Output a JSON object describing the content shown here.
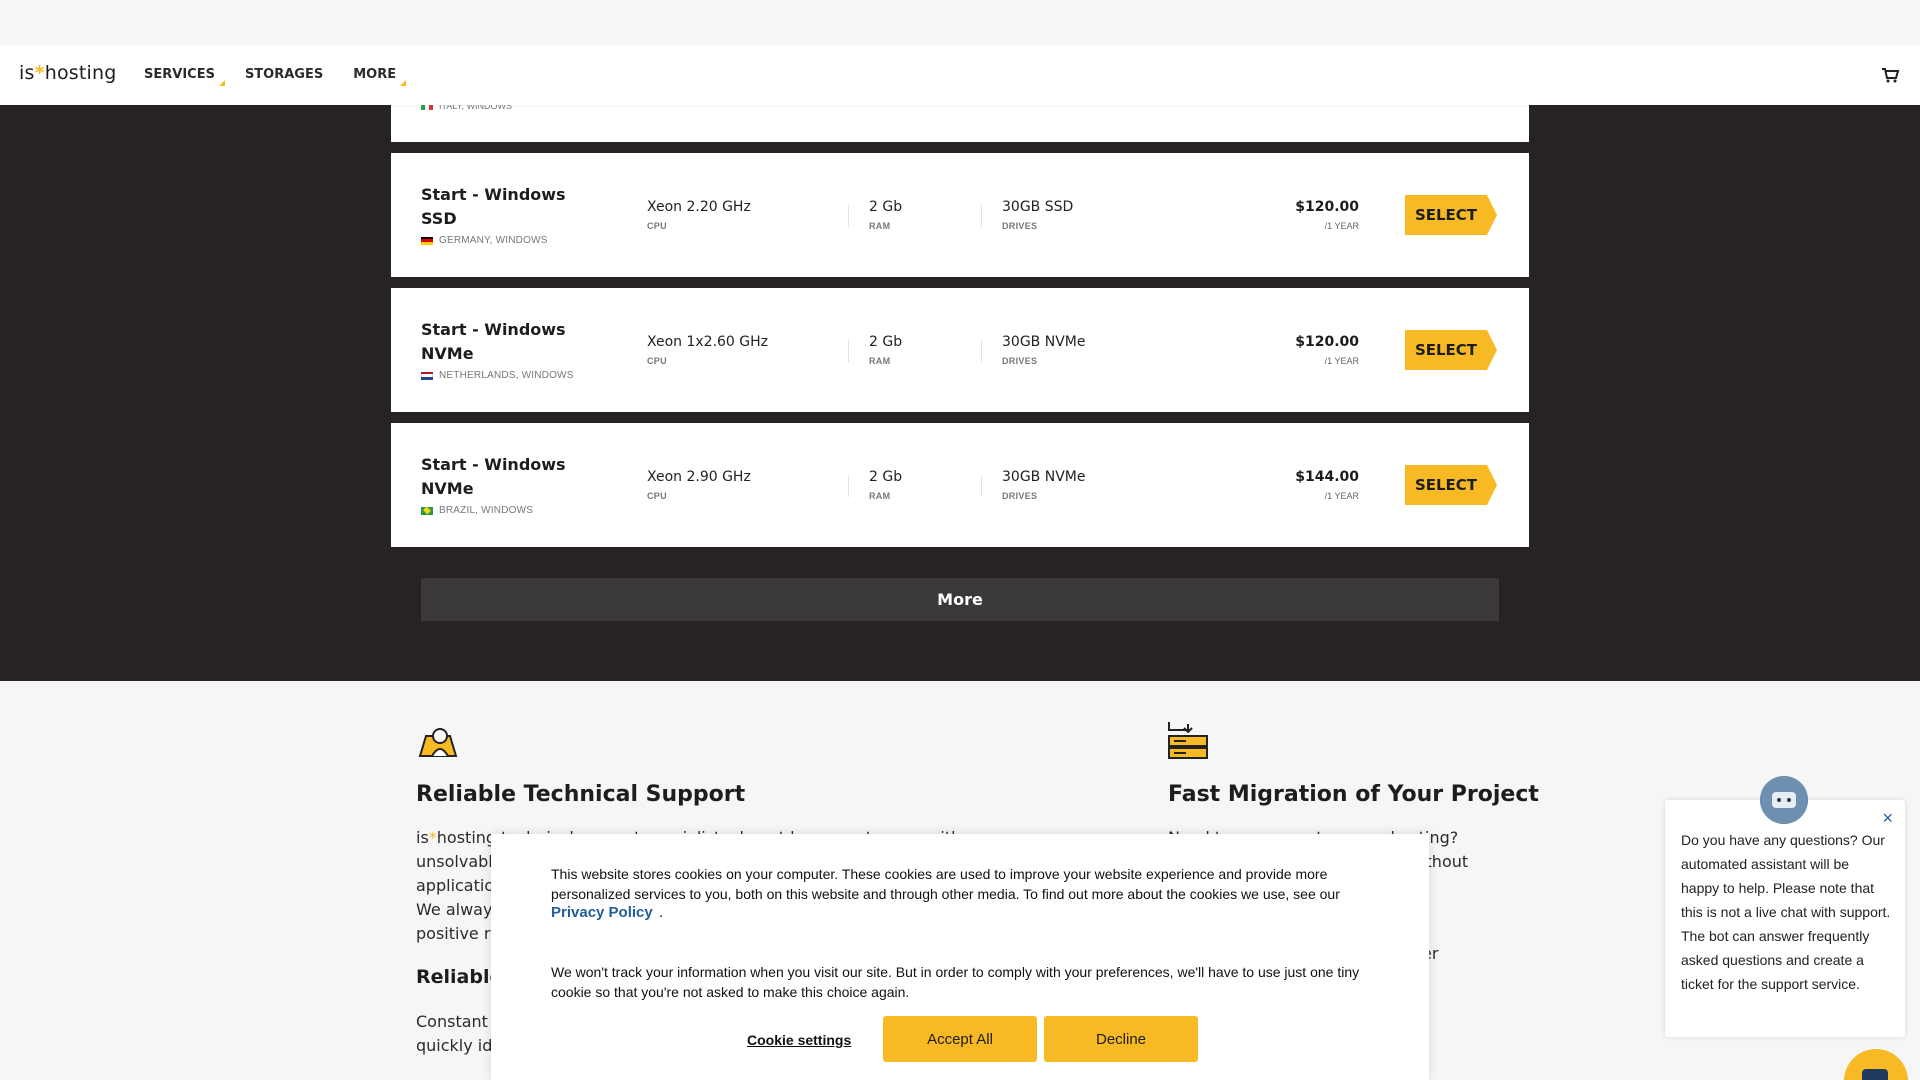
{
  "header": {
    "logo_left": "is",
    "logo_star": "*",
    "logo_right": "hosting",
    "nav": [
      "SERVICES",
      "STORAGES",
      "MORE"
    ]
  },
  "plans": {
    "partial_location": "ITALY, WINDOWS",
    "items": [
      {
        "name": "Start - Windows SSD",
        "location": "GERMANY, WINDOWS",
        "cpu": "Xeon 2.20 GHz",
        "ram": "2 Gb",
        "drives": "30GB SSD",
        "price": "$120.00",
        "period": "/1 YEAR"
      },
      {
        "name": "Start - Windows NVMe",
        "location": "NETHERLANDS, WINDOWS",
        "cpu": "Xeon 1x2.60 GHz",
        "ram": "2 Gb",
        "drives": "30GB NVMe",
        "price": "$120.00",
        "period": "/1 YEAR"
      },
      {
        "name": "Start - Windows NVMe",
        "location": "BRAZIL, WINDOWS",
        "cpu": "Xeon 2.90 GHz",
        "ram": "2 Gb",
        "drives": "30GB NVMe",
        "price": "$144.00",
        "period": "/1 YEAR"
      }
    ],
    "labels": {
      "cpu": "CPU",
      "ram": "RAM",
      "drives": "DRIVES",
      "select": "SELECT"
    },
    "more_label": "More"
  },
  "features": {
    "left": {
      "title": "Reliable Technical Support",
      "line1_start": "is",
      "line1_star": "*",
      "line1_rest": "hosting technical support specialists do not leave customers with an unsolvable",
      "line2": "application",
      "line3": "We always",
      "line4": "positive re",
      "sub": "Reliable p",
      "line5": "Constant m",
      "line6": "quickly ide"
    },
    "right": {
      "title": "Fast Migration of Your Project",
      "line1_a": "Need t",
      "line1_b": "to a new hosting?",
      "line2": "without",
      "line3": "sfer"
    }
  },
  "cookie": {
    "text1": "This website stores cookies on your computer. These cookies are used to improve your website experience and provide more personalized services to you, both on this website and through other media. To find out more about the cookies we use, see our",
    "privacy_link": "Privacy Policy",
    "privacy_dot": ".",
    "text2": "We won't track your information when you visit our site. But in order to comply with your preferences, we'll have to use just one tiny cookie so that you're not asked to make this choice again.",
    "settings_label": "Cookie settings",
    "accept_label": "Accept All",
    "decline_label": "Decline"
  },
  "chat": {
    "message": "Do you have any questions? Our automated assistant will be happy to help. Please note that this is not a live chat with support. The bot can answer frequently asked questions and create a ticket for the support service.",
    "close_glyph": "×"
  },
  "colors": {
    "accent": "#f7b924",
    "dark_bg": "#262322",
    "link": "#215f9a"
  },
  "icons": [
    "cart-icon",
    "support-icon",
    "migration-icon",
    "close-icon",
    "chat-icon"
  ]
}
